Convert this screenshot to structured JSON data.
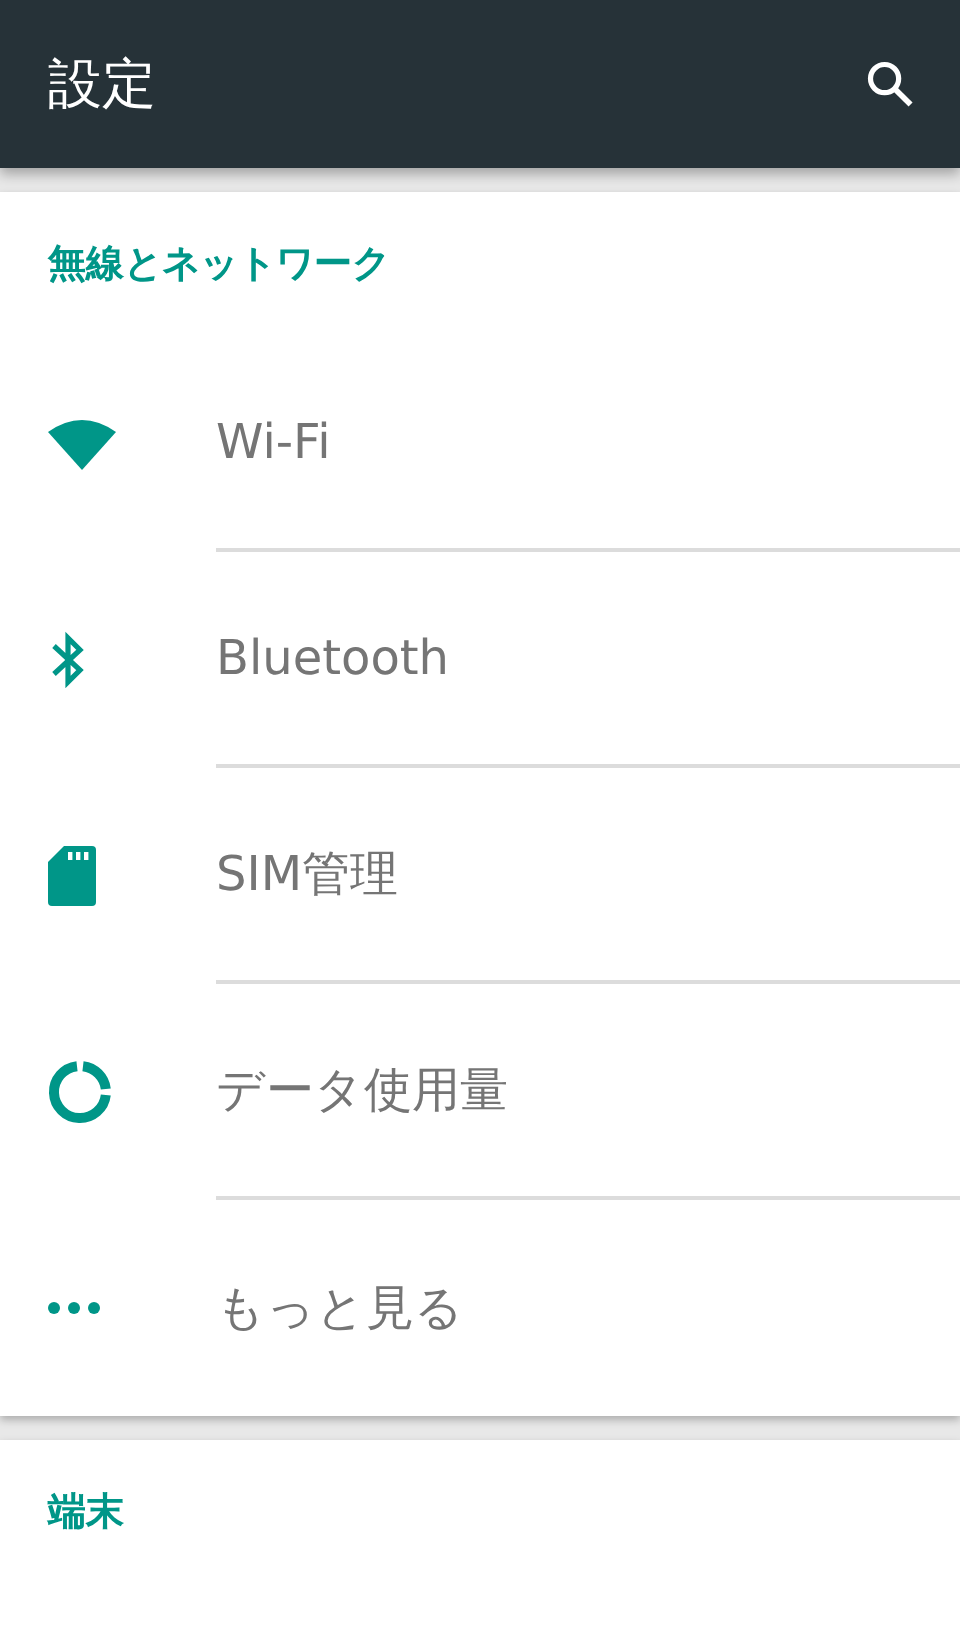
{
  "app_bar": {
    "title": "設定"
  },
  "sections": [
    {
      "title": "無線とネットワーク",
      "items": [
        {
          "kind": "wifi",
          "label": "Wi-Fi"
        },
        {
          "kind": "bluetooth",
          "label": "Bluetooth"
        },
        {
          "kind": "sim",
          "label": "SIM管理"
        },
        {
          "kind": "data",
          "label": "データ使用量"
        },
        {
          "kind": "more",
          "label": "もっと見る"
        }
      ]
    },
    {
      "title": "端末"
    }
  ]
}
